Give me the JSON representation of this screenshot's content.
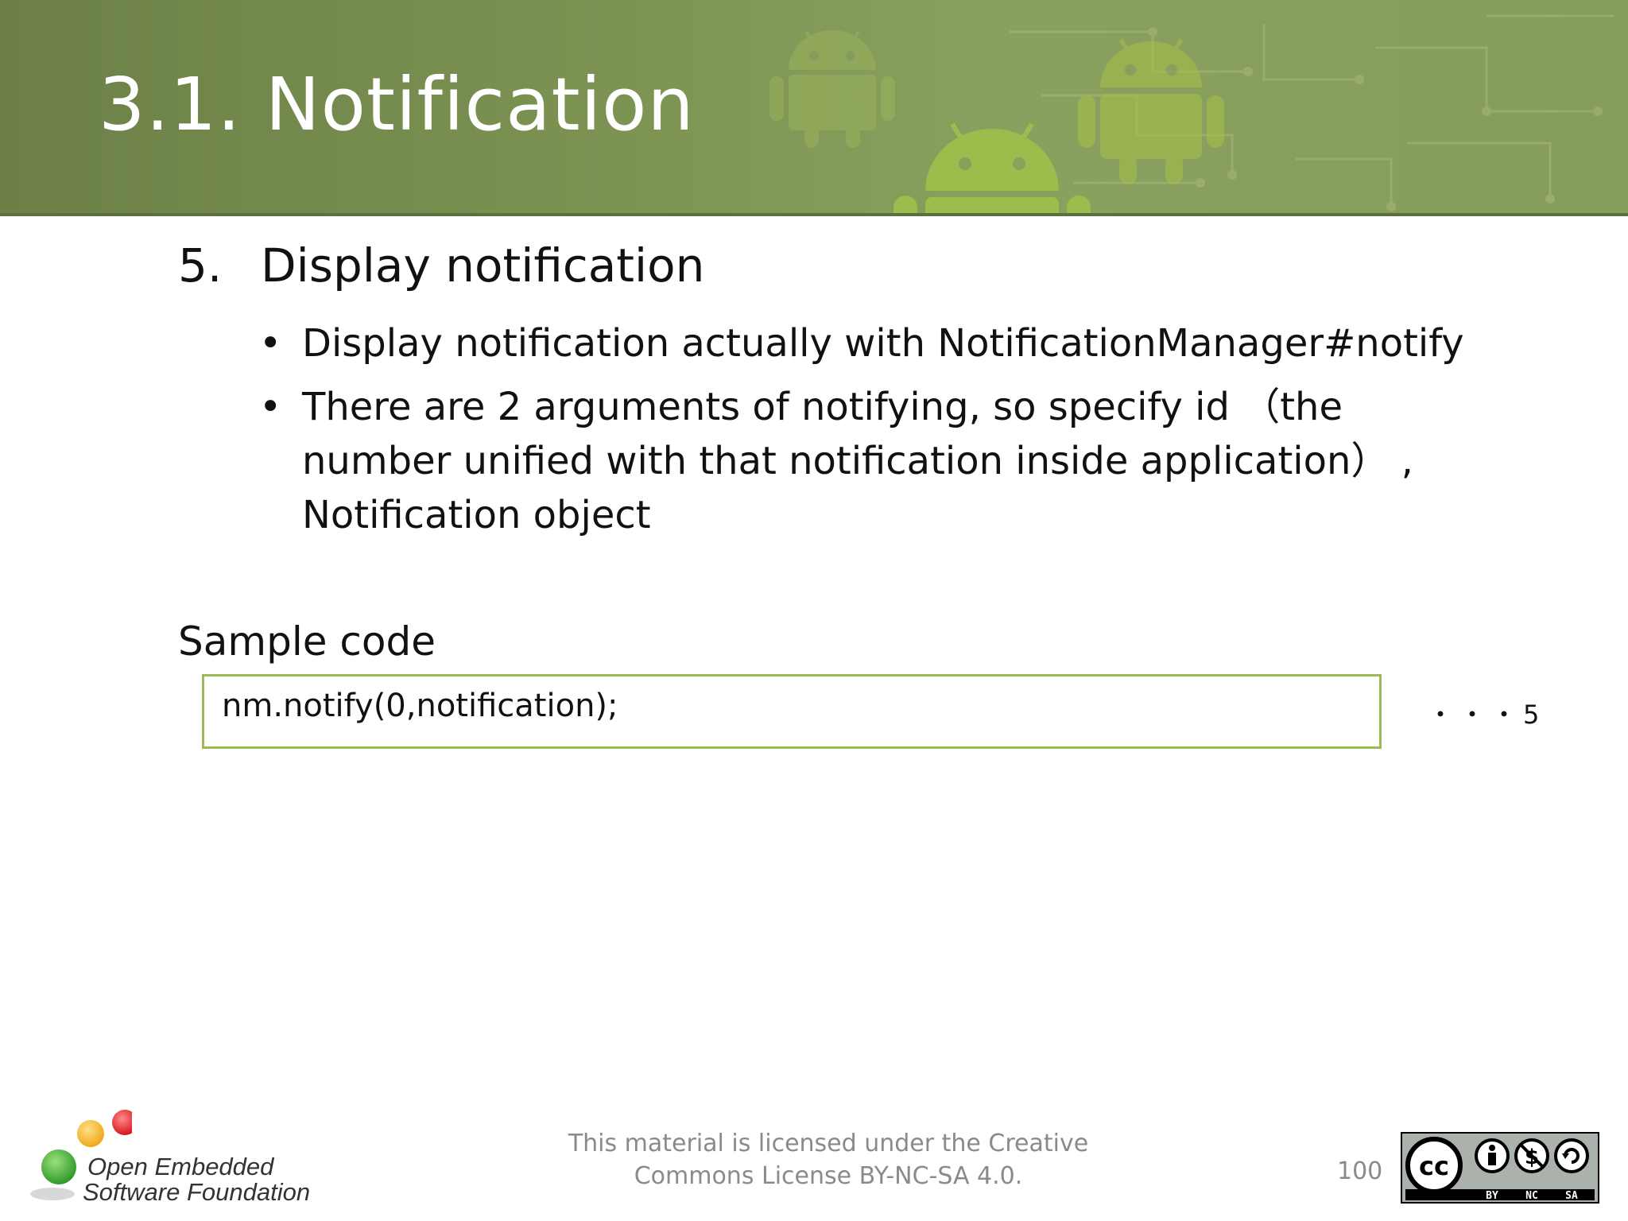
{
  "slide": {
    "title": "3.1. Notification",
    "step_number": "5.",
    "step_title": "Display notification",
    "bullets": [
      {
        "symbol": "•",
        "text": "Display notification actually with NotificationManager#notify"
      },
      {
        "symbol": "•",
        "text": "There are 2 arguments of notifying, so specify id （the number unified with that notification inside application） , Notification object"
      }
    ],
    "sample_heading": "Sample code",
    "code": "nm.notify(0,notification);",
    "code_marker": "・・・5"
  },
  "footer": {
    "logo_line1": "Open Embedded",
    "logo_line2": "Software Foundation",
    "license_line1": "This material is licensed under the Creative",
    "license_line2": "Commons License BY-NC-SA 4.0.",
    "page_number": "100",
    "cc_badge": {
      "cc_label": "cc",
      "by_label": "BY",
      "nc_label": "NC",
      "sa_label": "SA"
    }
  },
  "colors": {
    "header_green": "#7c9352",
    "code_border": "#9cbb58",
    "logo_green": "#3aa335",
    "logo_yellow": "#f3b21b",
    "logo_red": "#e8232a"
  },
  "icons": [
    "android-robot-icon",
    "open-embedded-logo",
    "creative-commons-icon"
  ]
}
